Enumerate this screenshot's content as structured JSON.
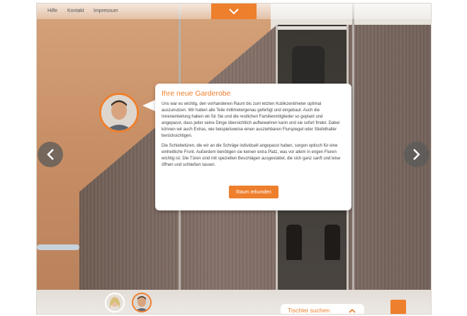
{
  "nav": {
    "links": [
      "Hilfe",
      "Kontakt",
      "Impressum"
    ]
  },
  "card": {
    "title": "Ihre neue Garderobe",
    "paragraphs": [
      "Uns war es wichtig, den vorhandenen Raum bis zum letzten Kubikzentimeter optimal auszunutzen. Wir  haben alle Teile millimetergenau gefertigt und eingebaut. Auch die Inneneinteilung haben wir für Sie und die restlichen Familienmitglieder so geplant und angepasst, dass jeder seine Dinge übersichtlich aufbewahren kann und sie sofort findet. Dabei können wir auch Extras, wie beispielsweise einen ausziehbaren Flurspiegel oder Stiefelhalter berücksichtigen.",
      "Die Schiebetüren, die wir an die Schräge individuell angepasst haben, sorgen optisch für eine einheitliche Front. Außerdem benötigen sie keinen extra Platz, was vor allem in engen Fluren wichtig ist. Die Türen sind mit speziellen Beschlägen ausgestattet, die sich ganz sanft und leise öffnen und schließen lassen."
    ],
    "button": "Raum erkunden"
  },
  "footer": {
    "finder_label": "Tischler suchen"
  },
  "icons": {
    "toggle": "chevron-down-icon",
    "prev": "chevron-left-icon",
    "next": "chevron-right-icon",
    "finder": "chevron-up-icon"
  },
  "colors": {
    "accent": "#ee7f2d",
    "text": "#444444"
  }
}
